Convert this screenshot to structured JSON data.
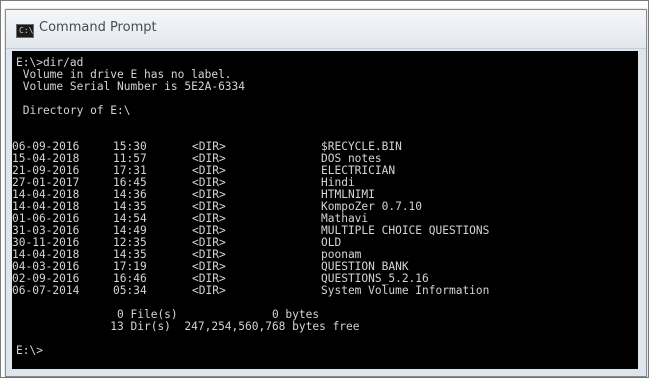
{
  "window": {
    "title": "Command Prompt",
    "icon_text": "C:\\"
  },
  "console": {
    "lines": [
      "E:\\>dir/ad",
      " Volume in drive E has no label.",
      " Volume Serial Number is 5E2A-6334",
      "",
      " Directory of E:\\"
    ],
    "entries": [
      {
        "date": "06-09-2016",
        "time": "15:30",
        "type": "<DIR>",
        "name": "$RECYCLE.BIN"
      },
      {
        "date": "15-04-2018",
        "time": "11:57",
        "type": "<DIR>",
        "name": "DOS notes"
      },
      {
        "date": "21-09-2016",
        "time": "17:31",
        "type": "<DIR>",
        "name": "ELECTRICIAN"
      },
      {
        "date": "27-01-2017",
        "time": "16:45",
        "type": "<DIR>",
        "name": "Hindi"
      },
      {
        "date": "14-04-2018",
        "time": "14:36",
        "type": "<DIR>",
        "name": "HTMLNIMI"
      },
      {
        "date": "14-04-2018",
        "time": "14:35",
        "type": "<DIR>",
        "name": "KompoZer 0.7.10"
      },
      {
        "date": "01-06-2016",
        "time": "14:54",
        "type": "<DIR>",
        "name": "Mathavi"
      },
      {
        "date": "31-03-2016",
        "time": "14:49",
        "type": "<DIR>",
        "name": "MULTIPLE CHOICE QUESTIONS"
      },
      {
        "date": "30-11-2016",
        "time": "12:35",
        "type": "<DIR>",
        "name": "OLD"
      },
      {
        "date": "14-04-2018",
        "time": "14:35",
        "type": "<DIR>",
        "name": "poonam"
      },
      {
        "date": "04-03-2016",
        "time": "17:19",
        "type": "<DIR>",
        "name": "QUESTION BANK"
      },
      {
        "date": "02-09-2016",
        "time": "16:46",
        "type": "<DIR>",
        "name": "QUESTIONS_5.2.16"
      },
      {
        "date": "06-07-2014",
        "time": "05:34",
        "type": "<DIR>",
        "name": "System Volume Information"
      }
    ],
    "summary_files": "               0 File(s)              0 bytes",
    "summary_dirs": "              13 Dir(s)  247,254,560,768 bytes free",
    "prompt": "E:\\>"
  }
}
